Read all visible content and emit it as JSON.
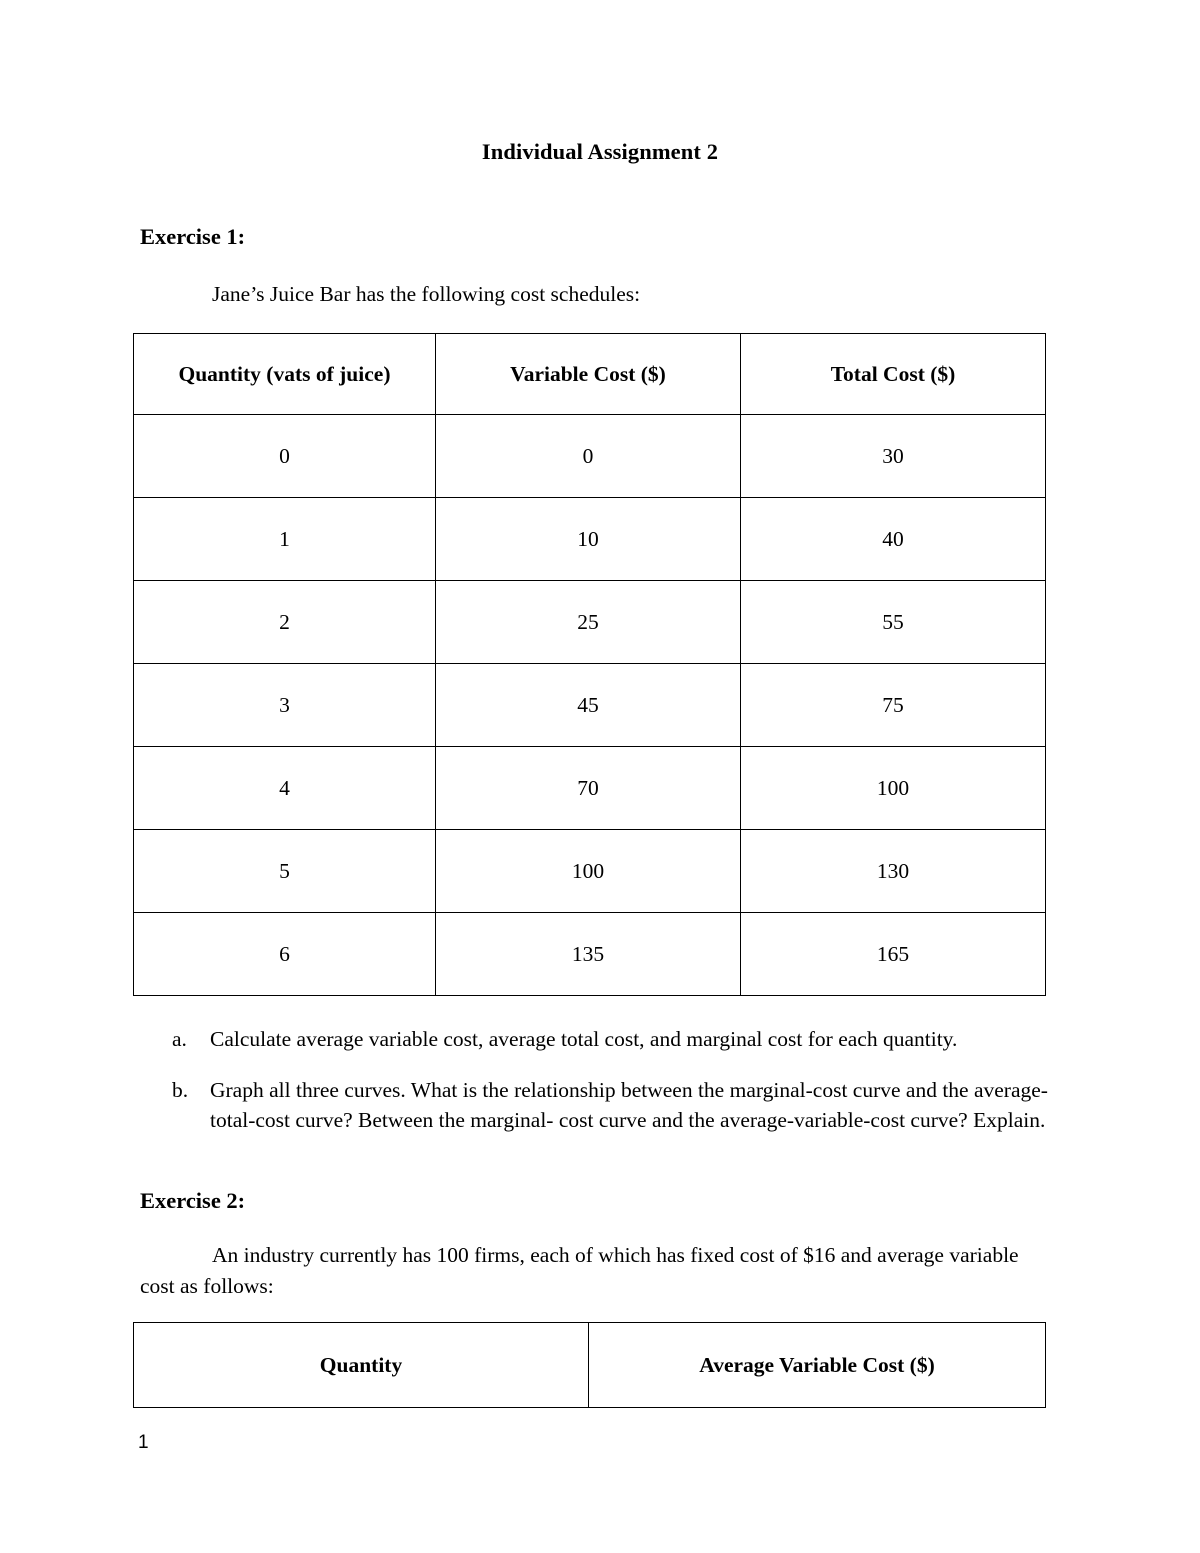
{
  "document": {
    "title": "Individual Assignment 2",
    "page_number": "1"
  },
  "exercise1": {
    "heading": "Exercise 1:",
    "intro": "Jane’s Juice Bar has the following cost schedules:",
    "table": {
      "headers": [
        "Quantity (vats of juice)",
        "Variable Cost ($)",
        "Total Cost ($)"
      ],
      "rows": [
        [
          "0",
          "0",
          "30"
        ],
        [
          "1",
          "10",
          "40"
        ],
        [
          "2",
          "25",
          "55"
        ],
        [
          "3",
          "45",
          "75"
        ],
        [
          "4",
          "70",
          "100"
        ],
        [
          "5",
          "100",
          "130"
        ],
        [
          "6",
          "135",
          "165"
        ]
      ]
    },
    "questions": [
      {
        "marker": "a.",
        "text": "Calculate average variable cost, average total cost, and marginal cost for each quantity."
      },
      {
        "marker": "b.",
        "text": "Graph all three curves. What is the relationship between the marginal-cost curve and the average-total-cost curve? Between the marginal- cost curve and the average-variable-cost curve? Explain."
      }
    ]
  },
  "exercise2": {
    "heading": "Exercise 2:",
    "intro": "An industry currently has 100 firms, each of which has fixed cost of $16 and average variable cost as follows:",
    "table": {
      "headers": [
        "Quantity",
        "Average Variable Cost ($)"
      ],
      "rows": []
    }
  },
  "chart_data": {
    "type": "table",
    "title": "Jane’s Juice Bar cost schedule",
    "columns": [
      "Quantity (vats of juice)",
      "Variable Cost ($)",
      "Total Cost ($)"
    ],
    "quantity": [
      0,
      1,
      2,
      3,
      4,
      5,
      6
    ],
    "series": [
      {
        "name": "Variable Cost ($)",
        "values": [
          0,
          10,
          25,
          45,
          70,
          100,
          135
        ]
      },
      {
        "name": "Total Cost ($)",
        "values": [
          30,
          40,
          55,
          75,
          100,
          130,
          165
        ]
      }
    ]
  }
}
